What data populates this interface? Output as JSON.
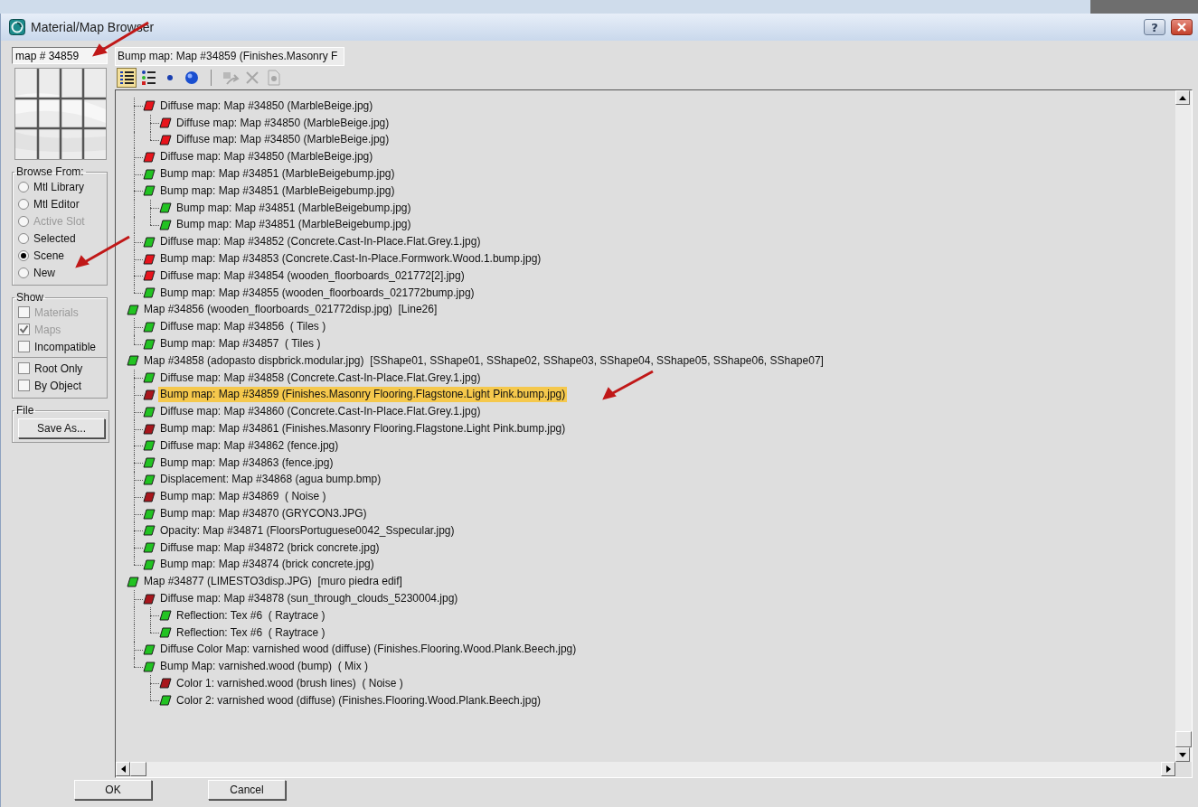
{
  "window": {
    "title": "Material/Map Browser",
    "help_button": "?"
  },
  "search": {
    "value": "map # 34859"
  },
  "selection_label": "Bump map: Map #34859 (Finishes.Masonry F",
  "toolbar": [
    {
      "kind": "list",
      "selected": true
    },
    {
      "kind": "list-icons",
      "selected": false
    },
    {
      "kind": "small-icons",
      "selected": false
    },
    {
      "kind": "large-icons",
      "selected": false
    },
    {
      "kind": "update",
      "disabled": true
    },
    {
      "kind": "delete",
      "disabled": true
    },
    {
      "kind": "clear",
      "disabled": true
    }
  ],
  "browse_from": {
    "title": "Browse From:",
    "options": [
      {
        "label": "Mtl Library",
        "selected": false,
        "disabled": false
      },
      {
        "label": "Mtl Editor",
        "selected": false,
        "disabled": false
      },
      {
        "label": "Active Slot",
        "selected": false,
        "disabled": true
      },
      {
        "label": "Selected",
        "selected": false,
        "disabled": false
      },
      {
        "label": "Scene",
        "selected": true,
        "disabled": false
      },
      {
        "label": "New",
        "selected": false,
        "disabled": false
      }
    ]
  },
  "show": {
    "title": "Show",
    "options": [
      {
        "label": "Materials",
        "checked": false,
        "disabled": true
      },
      {
        "label": "Maps",
        "checked": true,
        "disabled": true
      },
      {
        "label": "Incompatible",
        "checked": false,
        "disabled": false
      }
    ],
    "extra": [
      {
        "label": "Root Only",
        "checked": false,
        "disabled": false
      },
      {
        "label": "By Object",
        "checked": false,
        "disabled": false
      }
    ]
  },
  "file": {
    "title": "File",
    "button": "Save As..."
  },
  "tree": {
    "continued": [
      {
        "label": "Diffuse map: Map #34850 (MarbleBeige.jpg)",
        "color": "#e8141c",
        "selected": false,
        "children": [
          {
            "label": "Diffuse map: Map #34850 (MarbleBeige.jpg)",
            "color": "#e8141c",
            "selected": false
          },
          {
            "label": "Diffuse map: Map #34850 (MarbleBeige.jpg)",
            "color": "#e8141c",
            "selected": false
          }
        ]
      },
      {
        "label": "Diffuse map: Map #34850 (MarbleBeige.jpg)",
        "color": "#e8141c",
        "selected": false
      },
      {
        "label": "Bump map: Map #34851 (MarbleBeigebump.jpg)",
        "color": "#22c322",
        "selected": false
      },
      {
        "label": "Bump map: Map #34851 (MarbleBeigebump.jpg)",
        "color": "#22c322",
        "selected": false,
        "children": [
          {
            "label": "Bump map: Map #34851 (MarbleBeigebump.jpg)",
            "color": "#22c322",
            "selected": false
          },
          {
            "label": "Bump map: Map #34851 (MarbleBeigebump.jpg)",
            "color": "#22c322",
            "selected": false
          }
        ]
      },
      {
        "label": "Diffuse map: Map #34852 (Concrete.Cast-In-Place.Flat.Grey.1.jpg)",
        "color": "#22c322",
        "selected": false
      },
      {
        "label": "Bump map: Map #34853 (Concrete.Cast-In-Place.Formwork.Wood.1.bump.jpg)",
        "color": "#e8141c",
        "selected": false
      },
      {
        "label": "Diffuse map: Map #34854 (wooden_floorboards_021772[2].jpg)",
        "color": "#e8141c",
        "selected": false
      },
      {
        "label": "Bump map: Map #34855 (wooden_floorboards_021772bump.jpg)",
        "color": "#22c322",
        "selected": false
      }
    ],
    "roots": [
      {
        "label": "Map #34856 (wooden_floorboards_021772disp.jpg)  [Line26]",
        "color": "#22c322",
        "selected": false,
        "children": [
          {
            "label": "Diffuse map: Map #34856  ( Tiles )",
            "color": "#22c322",
            "selected": false
          },
          {
            "label": "Bump map: Map #34857  ( Tiles )",
            "color": "#22c322",
            "selected": false
          }
        ]
      },
      {
        "label": "Map #34858 (adopasto dispbrick.modular.jpg)  [SShape01, SShape01, SShape02, SShape03, SShape04, SShape05, SShape06, SShape07]",
        "color": "#22c322",
        "selected": false,
        "children": [
          {
            "label": "Diffuse map: Map #34858 (Concrete.Cast-In-Place.Flat.Grey.1.jpg)",
            "color": "#22c322",
            "selected": false
          },
          {
            "label": "Bump map: Map #34859 (Finishes.Masonry Flooring.Flagstone.Light Pink.bump.jpg)",
            "color": "#a8161c",
            "selected": true
          },
          {
            "label": "Diffuse map: Map #34860 (Concrete.Cast-In-Place.Flat.Grey.1.jpg)",
            "color": "#22c322",
            "selected": false
          },
          {
            "label": "Bump map: Map #34861 (Finishes.Masonry Flooring.Flagstone.Light Pink.bump.jpg)",
            "color": "#a8161c",
            "selected": false
          },
          {
            "label": "Diffuse map: Map #34862 (fence.jpg)",
            "color": "#22c322",
            "selected": false
          },
          {
            "label": "Bump map: Map #34863 (fence.jpg)",
            "color": "#22c322",
            "selected": false
          },
          {
            "label": "Displacement: Map #34868 (agua bump.bmp)",
            "color": "#22c322",
            "selected": false
          },
          {
            "label": "Bump map: Map #34869  ( Noise )",
            "color": "#a8161c",
            "selected": false
          },
          {
            "label": "Bump map: Map #34870 (GRYCON3.JPG)",
            "color": "#22c322",
            "selected": false
          },
          {
            "label": "Opacity: Map #34871 (FloorsPortuguese0042_Sspecular.jpg)",
            "color": "#22c322",
            "selected": false
          },
          {
            "label": "Diffuse map: Map #34872 (brick concrete.jpg)",
            "color": "#22c322",
            "selected": false
          },
          {
            "label": "Bump map: Map #34874 (brick concrete.jpg)",
            "color": "#22c322",
            "selected": false
          }
        ]
      },
      {
        "label": "Map #34877 (LIMESTO3disp.JPG)  [muro piedra edif]",
        "color": "#22c322",
        "selected": false,
        "children": [
          {
            "label": "Diffuse map: Map #34878 (sun_through_clouds_5230004.jpg)",
            "color": "#a8161c",
            "selected": false,
            "children": [
              {
                "label": "Reflection: Tex #6  ( Raytrace )",
                "color": "#22c322",
                "selected": false
              },
              {
                "label": "Reflection: Tex #6  ( Raytrace )",
                "color": "#22c322",
                "selected": false
              }
            ]
          },
          {
            "label": "Diffuse Color Map: varnished wood (diffuse) (Finishes.Flooring.Wood.Plank.Beech.jpg)",
            "color": "#22c322",
            "selected": false
          },
          {
            "label": "Bump Map: varnished.wood (bump)  ( Mix )",
            "color": "#22c322",
            "selected": false,
            "children": [
              {
                "label": "Color 1: varnished.wood (brush lines)  ( Noise )",
                "color": "#a8161c",
                "selected": false
              },
              {
                "label": "Color 2: varnished wood (diffuse) (Finishes.Flooring.Wood.Plank.Beech.jpg)",
                "color": "#22c322",
                "selected": false
              }
            ]
          }
        ]
      }
    ]
  },
  "buttons": [
    "OK",
    "Cancel"
  ]
}
